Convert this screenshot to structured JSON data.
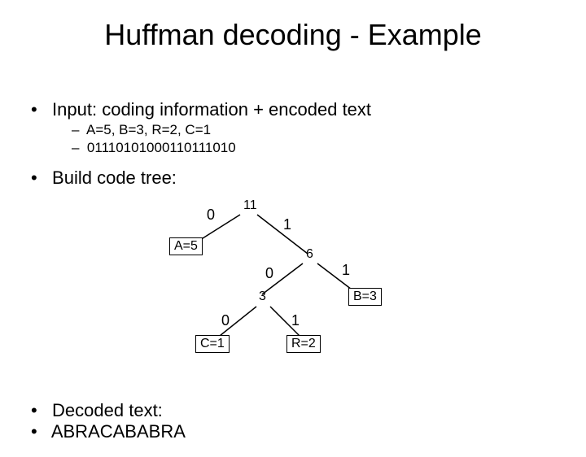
{
  "title": "Huffman decoding - Example",
  "bullets": {
    "b1": "Input: coding information + encoded text",
    "s1": "A=5, B=3, R=2, C=1",
    "s2": "01110101000110111010",
    "b2": "Build code tree:",
    "b3": "Decoded text:",
    "b4": "ABRACABABRA"
  },
  "tree": {
    "root": "11",
    "n6": "6",
    "n3": "3",
    "A": "A=5",
    "B": "B=3",
    "C": "C=1",
    "R": "R=2",
    "e0a": "0",
    "e1a": "1",
    "e0b": "0",
    "e1b": "1",
    "e0c": "0",
    "e1c": "1"
  },
  "dot": "•",
  "dash": "–"
}
